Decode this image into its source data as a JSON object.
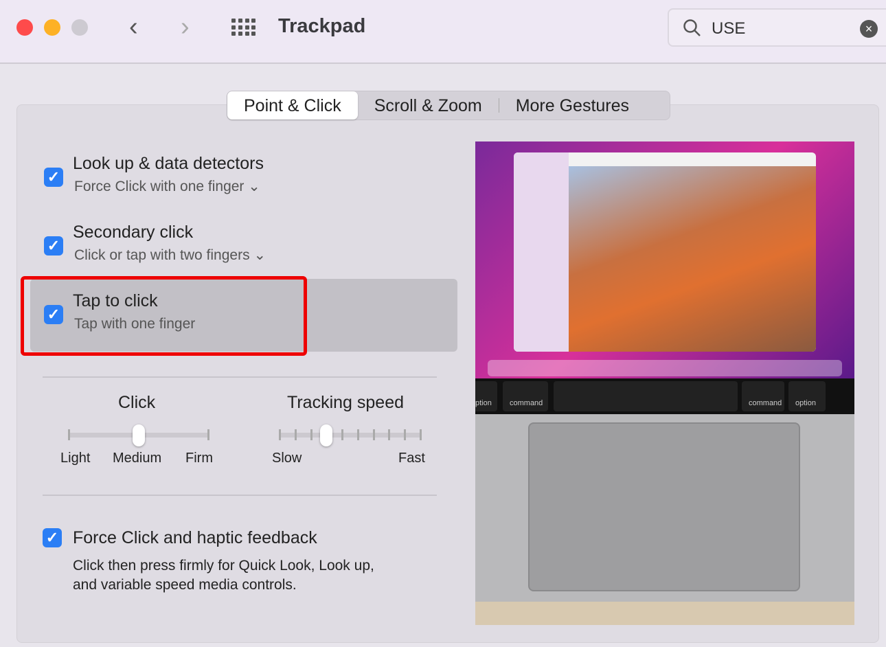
{
  "window": {
    "title": "Trackpad",
    "search_value": "USE"
  },
  "tabs": [
    {
      "label": "Point & Click",
      "active": true
    },
    {
      "label": "Scroll & Zoom"
    },
    {
      "label": "More Gestures"
    }
  ],
  "options": [
    {
      "label": "Look up & data detectors",
      "sub": "Force Click with one finger",
      "checked": true,
      "has_dropdown": true
    },
    {
      "label": "Secondary click",
      "sub": "Click or tap with two fingers",
      "checked": true,
      "has_dropdown": true
    },
    {
      "label": "Tap to click",
      "sub": "Tap with one finger",
      "checked": true,
      "highlighted": true
    }
  ],
  "click_slider": {
    "title": "Click",
    "labels": [
      "Light",
      "Medium",
      "Firm"
    ],
    "value": "Medium",
    "fraction": 0.5
  },
  "tracking_slider": {
    "title": "Tracking speed",
    "min_label": "Slow",
    "max_label": "Fast",
    "fraction": 0.333,
    "ticks": 10
  },
  "force_click": {
    "label": "Force Click and haptic feedback",
    "desc1": "Click then press firmly for Quick Look, Look up,",
    "desc2": "and variable speed media controls.",
    "checked": true
  },
  "preview_keys": [
    "ption",
    "command",
    "command",
    "option"
  ],
  "colors": {
    "accent": "#2b7ef5",
    "highlight_border": "#e00000"
  }
}
